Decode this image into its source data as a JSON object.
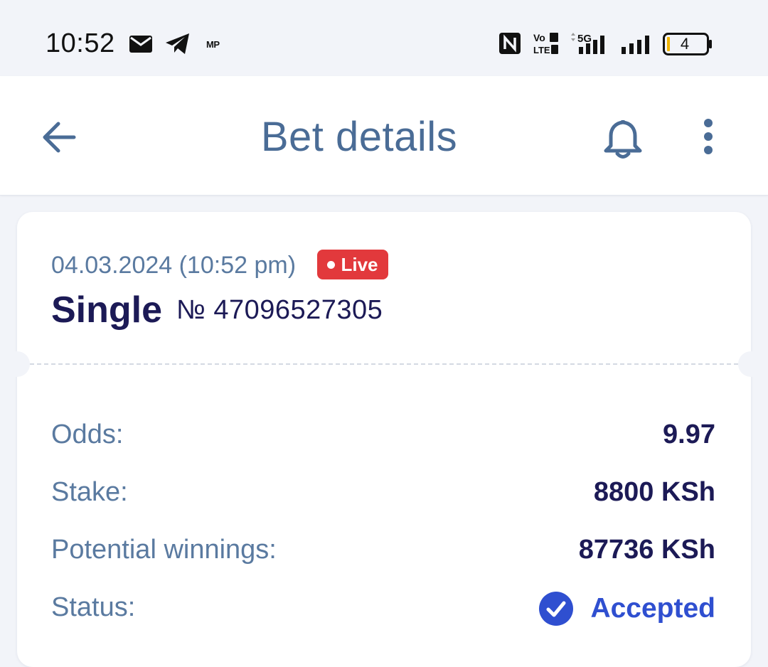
{
  "status_bar": {
    "time": "10:52",
    "notifications": [
      "mail-icon",
      "telegram-icon",
      "mp-icon"
    ],
    "mp_label": "MP",
    "volte_label_top": "Vo",
    "volte_label_bottom": "LTE",
    "network_label": "5G",
    "battery_level": "4"
  },
  "app_bar": {
    "title": "Bet details",
    "back_icon": "arrow-left-icon",
    "bell_icon": "bell-icon",
    "more_icon": "more-vertical-icon",
    "accent_color": "#4a6c96"
  },
  "bet": {
    "date": "04.03.2024 (10:52 pm)",
    "live_label": "Live",
    "type": "Single",
    "number": "№ 47096527305",
    "rows": {
      "odds_label": "Odds:",
      "odds_value": "9.97",
      "stake_label": "Stake:",
      "stake_value": "8800 KSh",
      "winnings_label": "Potential winnings:",
      "winnings_value": "87736 KSh",
      "status_label": "Status:",
      "status_value": "Accepted"
    },
    "colors": {
      "live": "#e2393c",
      "accepted": "#2f4fd0",
      "value_text": "#1c1a56",
      "label_text": "#5a7aa0"
    }
  }
}
